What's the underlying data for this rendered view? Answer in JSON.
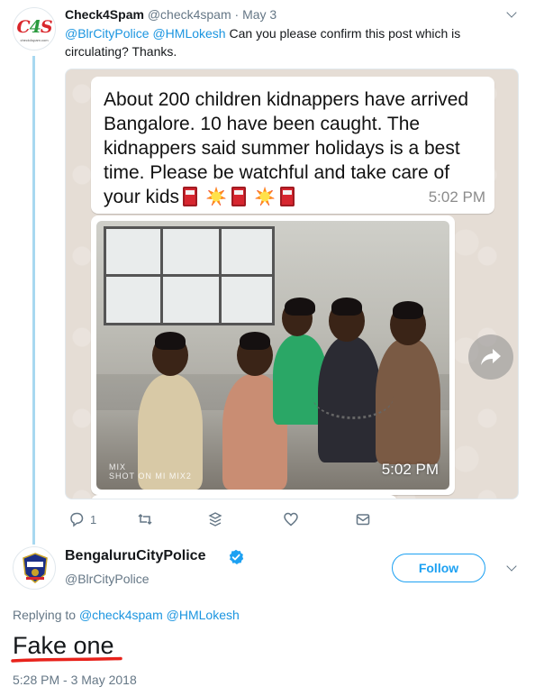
{
  "tweet1": {
    "avatar_logo": {
      "c": "C",
      "n": "4",
      "s": "S"
    },
    "avatar_sub": "check4spam.com",
    "name": "Check4Spam",
    "handle": "@check4spam",
    "dot": "·",
    "date": "May 3",
    "mentions": [
      "@BlrCityPolice",
      "@HMLokesh"
    ],
    "text": "Can you please confirm this post which is circulating? Thanks.",
    "media": {
      "message": "About 200 children kidnappers have arrived Bangalore. 10 have been caught. The kidnappers said summer holidays is a best time. Please be watchful and take care of your kids",
      "message_time": "5:02 PM",
      "photo_watermark_line1": "MIX",
      "photo_watermark_line2": "SHOT ON MI MIX2",
      "photo_time": "5:02 PM"
    },
    "actions": {
      "reply_count": "1",
      "retweet_count": "",
      "like_count": ""
    }
  },
  "tweet2": {
    "name": "BengaluruCityPolice",
    "handle": "@BlrCityPolice",
    "follow_label": "Follow",
    "replying_prefix": "Replying to",
    "replying_to": "@check4spam @HMLokesh",
    "text": "Fake one",
    "timestamp": "5:28 PM - 3 May 2018",
    "underline_color": "#e8221b"
  },
  "colors": {
    "link": "#1b95e0",
    "thread_line": "#a8d8f0",
    "follow": "#1da1f2",
    "verified": "#1da1f2"
  }
}
